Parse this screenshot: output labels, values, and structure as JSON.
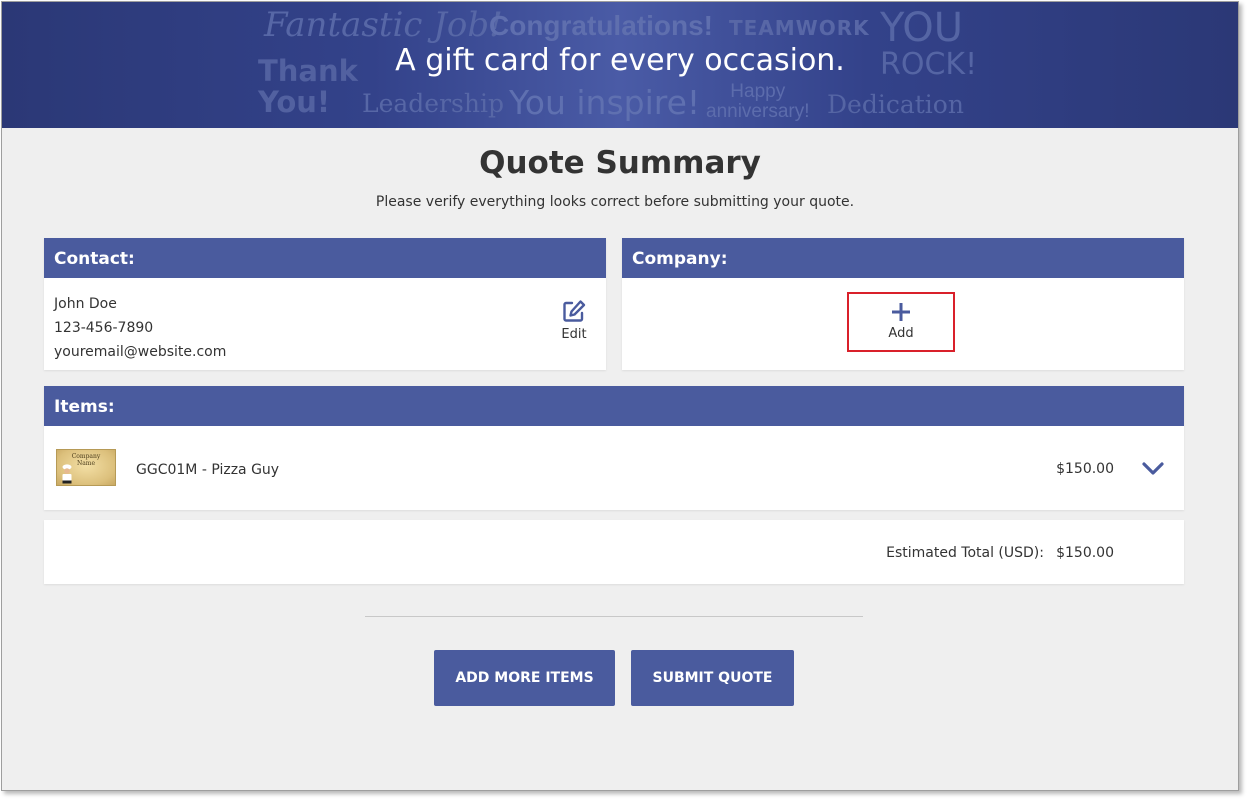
{
  "banner": {
    "headline": "A gift card for every occasion.",
    "words": {
      "fantastic": "Fantastic Job!",
      "congratulations": "Congratulations!",
      "teamwork": "TEAMWORK",
      "you": "YOU",
      "rock": "ROCK!",
      "thank": "Thank",
      "thank_you": "You!",
      "leadership": "Leadership",
      "inspire": "You inspire!",
      "happy": "Happy",
      "anniversary": "anniversary!",
      "dedication": "Dedication"
    }
  },
  "page": {
    "title": "Quote Summary",
    "subtitle": "Please verify everything looks correct before submitting your quote."
  },
  "contact": {
    "header": "Contact:",
    "name": "John Doe",
    "phone": "123-456-7890",
    "email": "youremail@website.com",
    "edit_label": "Edit"
  },
  "company": {
    "header": "Company:",
    "add_label": "Add"
  },
  "items": {
    "header": "Items:",
    "list": [
      {
        "name": "GGC01M - Pizza Guy",
        "price": "$150.00",
        "thumb_line1": "Company",
        "thumb_line2": "Name"
      }
    ]
  },
  "total": {
    "label": "Estimated Total (USD):",
    "value": "$150.00"
  },
  "buttons": {
    "add_more": "ADD MORE ITEMS",
    "submit": "SUBMIT QUOTE"
  },
  "icons": {
    "edit": "pencil-square-icon",
    "add": "plus-icon",
    "expand": "chevron-down-icon"
  },
  "colors": {
    "primary": "#4a5b9e",
    "banner": "#2b3876",
    "highlight": "#d9202a",
    "background": "#efefef"
  }
}
